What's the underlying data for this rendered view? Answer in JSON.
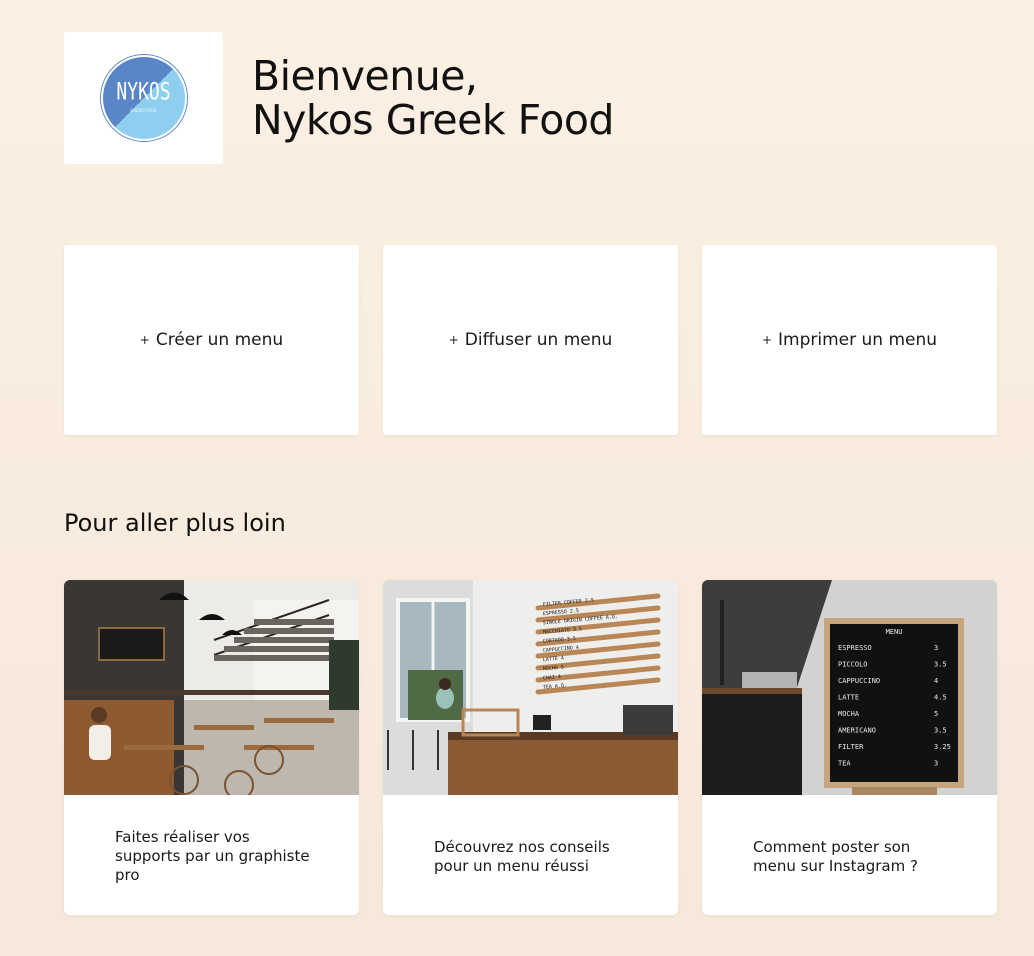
{
  "logo": {
    "text": "NYKOS",
    "sub": "GREEK FOOD"
  },
  "welcome": {
    "line1": "Bienvenue,",
    "line2": "Nykos Greek Food"
  },
  "actions": [
    {
      "plus": "+",
      "label": "Créer un menu"
    },
    {
      "plus": "+",
      "label": "Diffuser un menu"
    },
    {
      "plus": "+",
      "label": "Imprimer un menu"
    }
  ],
  "section_title": "Pour aller plus loin",
  "articles": [
    {
      "text": "Faites réaliser vos supports par un graphiste pro"
    },
    {
      "text": "Découvrez nos conseils pour un menu réussi"
    },
    {
      "text": "Comment poster son menu sur Instagram ?"
    }
  ],
  "coffee_board": {
    "items": [
      "FILTER COFFEE 2.5",
      "ESPRESSO 2.5",
      "SINGLE ORIGIN COFFEE A.Q.",
      "MACCHIATO 3.5",
      "CORTADO 3.5",
      "CAPPUCCINO 4",
      "LATTE 4",
      "MOCHA 5",
      "CHAI 4",
      "TEA A.Q."
    ]
  },
  "letter_board": {
    "title": "MENU",
    "items": [
      {
        "name": "ESPRESSO",
        "price": "3"
      },
      {
        "name": "PICCOLO",
        "price": "3.5"
      },
      {
        "name": "CAPPUCCINO",
        "price": "4"
      },
      {
        "name": "LATTE",
        "price": "4.5"
      },
      {
        "name": "MOCHA",
        "price": "5"
      },
      {
        "name": "AMERICANO",
        "price": "3.5"
      },
      {
        "name": "FILTER",
        "price": "3.25"
      },
      {
        "name": "TEA",
        "price": "3"
      }
    ]
  }
}
